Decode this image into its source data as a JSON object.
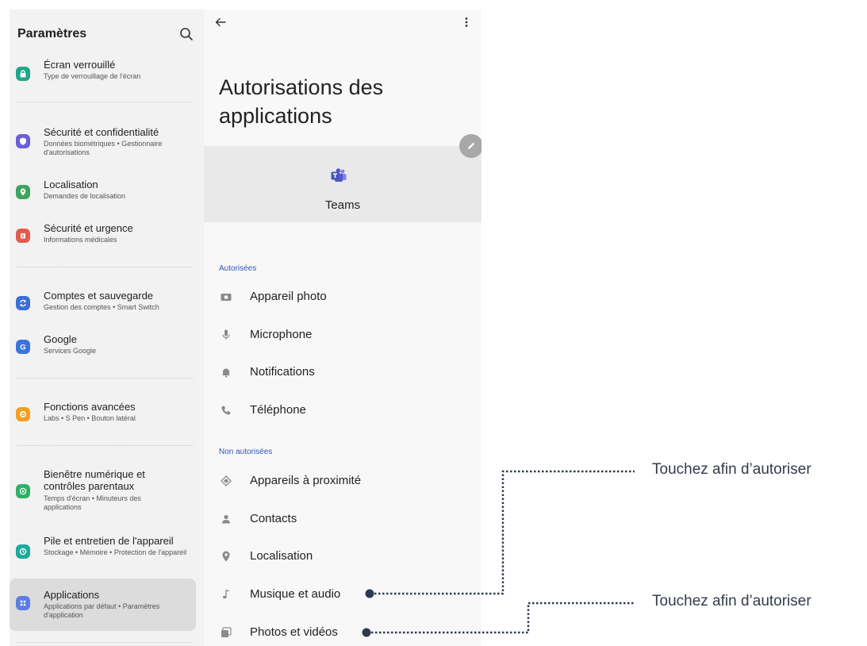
{
  "sidebar": {
    "title": "Paramètres",
    "items": [
      {
        "title": "Écran verrouillé",
        "subtitle": "Type de verrouillage de l'écran"
      },
      {
        "title": "Sécurité et confidentialité",
        "subtitle": "Données biométriques • Gestionnaire d'autorisations"
      },
      {
        "title": "Localisation",
        "subtitle": "Demandes de localisation"
      },
      {
        "title": "Sécurité et urgence",
        "subtitle": "Informations médicales"
      },
      {
        "title": "Comptes et sauvegarde",
        "subtitle": "Gestion des comptes • Smart Switch"
      },
      {
        "title": "Google",
        "subtitle": "Services Google"
      },
      {
        "title": "Fonctions avancées",
        "subtitle": "Labs • S Pen • Bouton latéral"
      },
      {
        "title": "Bienêtre numérique et contrôles parentaux",
        "subtitle": "Temps d'écran • Minuteurs des applications"
      },
      {
        "title": "Pile et entretien de l'appareil",
        "subtitle": "Stockage • Mémoire • Protection de l'appareil"
      },
      {
        "title": "Applications",
        "subtitle": "Applications par défaut • Paramètres d'application"
      }
    ]
  },
  "main": {
    "title": "Autorisations des applications",
    "app_name": "Teams",
    "allowed_label": "Autorisées",
    "allowed": [
      "Appareil photo",
      "Microphone",
      "Notifications",
      "Téléphone"
    ],
    "denied_label": "Non autorisées",
    "denied": [
      "Appareils à proximité",
      "Contacts",
      "Localisation",
      "Musique et audio",
      "Photos et vidéos"
    ]
  },
  "callouts": [
    "Touchez afin d’autoriser",
    "Touchez afin d’autoriser"
  ],
  "colors": {
    "accent": "#2e56b8",
    "callout_line": "#2f3a4f",
    "lock": "#1fa58a",
    "security": "#6a5fd6",
    "location": "#3fa35b",
    "emergency": "#e35b4f",
    "accounts": "#3b6fd6",
    "google": "#3b74e0",
    "advanced": "#f0a020",
    "wellbeing": "#2fae6a",
    "battery": "#1ea99a",
    "apps": "#5b7ee6"
  },
  "icons": {
    "search": "search-icon",
    "back": "back-arrow-icon",
    "more": "more-vertical-icon",
    "edit": "pencil-icon",
    "app": "teams-logo-icon"
  }
}
